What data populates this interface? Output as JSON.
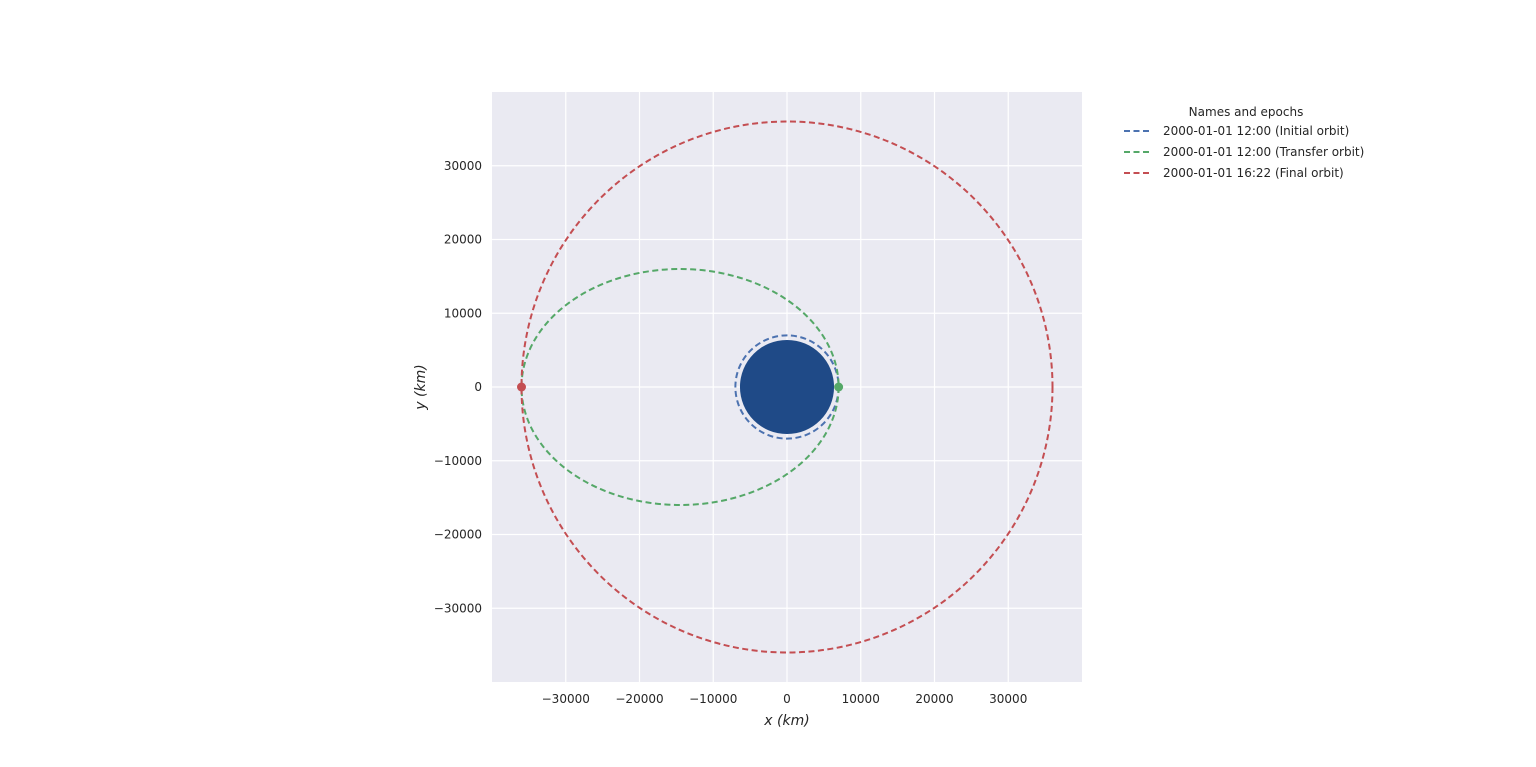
{
  "chart_data": {
    "type": "line",
    "xlabel": "x (km)",
    "ylabel": "y (km)",
    "xlim": [
      -40000,
      40000
    ],
    "ylim": [
      -40000,
      40000
    ],
    "grid": true,
    "background": "#eaeaf2",
    "x_ticks": [
      -30000,
      -20000,
      -10000,
      0,
      10000,
      20000,
      30000
    ],
    "y_ticks": [
      -30000,
      -20000,
      -10000,
      0,
      10000,
      20000,
      30000
    ],
    "x_tick_labels": [
      "−30000",
      "−20000",
      "−10000",
      "0",
      "10000",
      "20000",
      "30000"
    ],
    "y_tick_labels": [
      "−30000",
      "−20000",
      "−10000",
      "0",
      "10000",
      "20000",
      "30000"
    ],
    "attractor": {
      "radius": 6378,
      "color": "#1f4a87"
    },
    "legend": {
      "title": "Names and epochs",
      "placement": "outside-top-right"
    },
    "series": [
      {
        "name": "2000-01-01 12:00 (Initial orbit)",
        "color": "#4c72b0",
        "kind": "ellipse",
        "center": [
          0,
          0
        ],
        "semi_major": 7000,
        "semi_minor": 7000,
        "marker": null
      },
      {
        "name": "2000-01-01 12:00 (Transfer orbit)",
        "color": "#55a868",
        "kind": "ellipse",
        "center": [
          -14500,
          0
        ],
        "semi_major": 21500,
        "semi_minor": 16000,
        "marker": [
          7000,
          0
        ]
      },
      {
        "name": "2000-01-01 16:22 (Final orbit)",
        "color": "#c44e52",
        "kind": "ellipse",
        "center": [
          0,
          0
        ],
        "semi_major": 36000,
        "semi_minor": 36000,
        "marker": [
          -36000,
          0
        ]
      }
    ]
  }
}
